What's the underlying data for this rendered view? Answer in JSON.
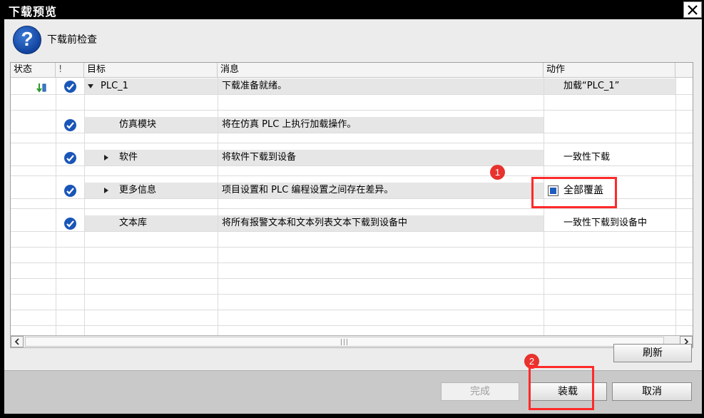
{
  "window": {
    "title": "下载预览"
  },
  "header": {
    "label": "下载前检查",
    "icon": "question-icon"
  },
  "columns": {
    "status": "状态",
    "warn": "!",
    "target": "目标",
    "message": "消息",
    "action": "动作"
  },
  "rows": [
    {
      "target": "PLC_1",
      "message": "下载准备就绪。",
      "action": "加载“PLC_1”"
    },
    {
      "target": "仿真模块",
      "message": "将在仿真 PLC 上执行加载操作。",
      "action": ""
    },
    {
      "target": "软件",
      "message": "将软件下载到设备",
      "action": "一致性下载"
    },
    {
      "target": "更多信息",
      "message": "项目设置和 PLC 编程设置之间存在差异。",
      "action": "全部覆盖"
    },
    {
      "target": "文本库",
      "message": "将所有报警文本和文本列表文本下载到设备中",
      "action": "一致性下载到设备中"
    }
  ],
  "buttons": {
    "refresh": "刷新",
    "finish": "完成",
    "load": "装载",
    "cancel": "取消"
  },
  "annotations": {
    "badge1": "1",
    "badge2": "2"
  },
  "colors": {
    "check": "#1a56b8",
    "highlight": "#ff2a2a",
    "badge": "#e8322e"
  }
}
